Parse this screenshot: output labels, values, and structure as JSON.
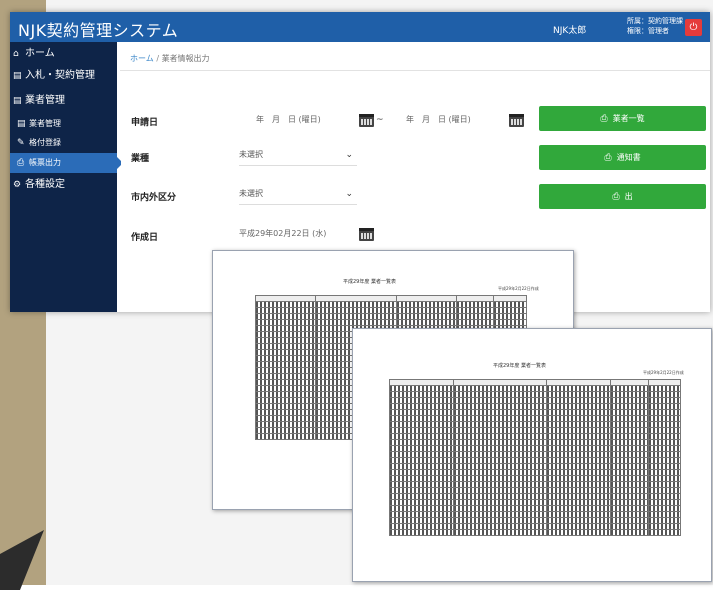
{
  "app": {
    "title": "NJK契約管理システム",
    "user_name": "NJK太郎",
    "user_dept": "所属：契約管理課",
    "user_role": "権限：管理者",
    "logout_icon": "power-icon"
  },
  "sidebar": {
    "items": [
      {
        "label": "ホーム",
        "icon": "home-icon"
      },
      {
        "label": "入札・契約管理",
        "icon": "list-icon"
      },
      {
        "label": "業者管理",
        "icon": "list-icon"
      },
      {
        "label": "業者管理",
        "icon": "list-icon"
      },
      {
        "label": "格付登録",
        "icon": "pen-icon"
      },
      {
        "label": "帳票出力",
        "icon": "print-icon"
      },
      {
        "label": "各種設定",
        "icon": "gear-icon"
      }
    ]
  },
  "breadcrumb": {
    "home": "ホーム",
    "sep": "/",
    "current": "業者情報出力"
  },
  "form": {
    "application_date_label": "申請日",
    "date_parts": [
      "年",
      "月",
      "日 (曜日)"
    ],
    "tilde": "~",
    "industry_label": "業種",
    "industry_value": "未選択",
    "area_label": "市内外区分",
    "area_value": "未選択",
    "created_date_label": "作成日",
    "created_date_value": "平成29年02月22日 (水)"
  },
  "buttons": {
    "list_label": "業者一覧",
    "notice_label": "通知書",
    "third_label": "出"
  },
  "reports": [
    {
      "title": "平成29年度 業者一覧表",
      "meta": "平成29年2月22日作成"
    },
    {
      "title": "平成29年度 業者一覧表",
      "meta": "平成29年2月22日作成"
    }
  ],
  "colors": {
    "topbar": "#1f5fa8",
    "sidebar": "#0e2448",
    "active": "#2b6cb8",
    "button": "#31a83b",
    "logout": "#e53b3b"
  }
}
